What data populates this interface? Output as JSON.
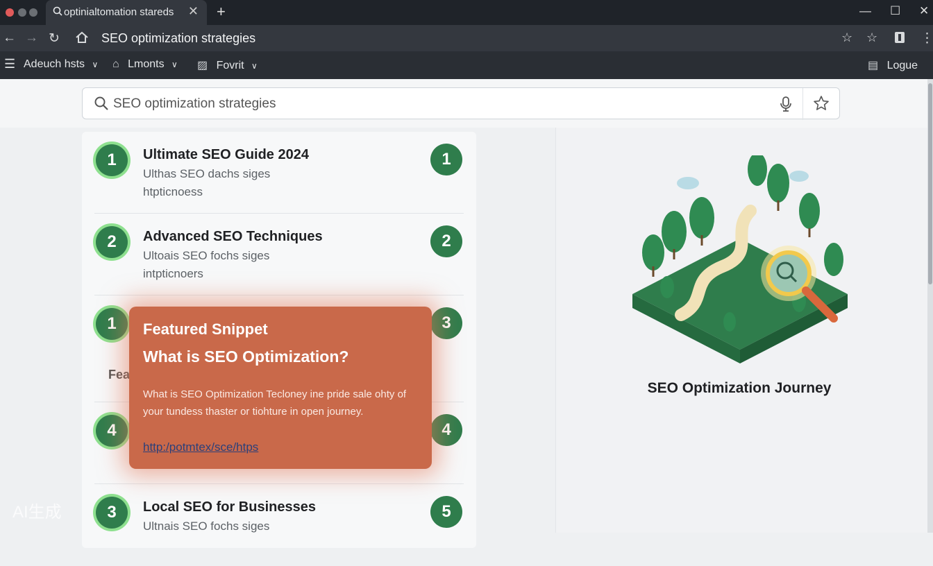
{
  "browser": {
    "tab_title": "optinialtomation stareds",
    "new_tab": "+",
    "address": "SEO optimization strategies"
  },
  "bookmarks": [
    {
      "label": "Adeuch hsts"
    },
    {
      "label": "Lmonts"
    },
    {
      "label": "Fovrit"
    }
  ],
  "bookmark_right": "Logue",
  "search": {
    "query": "SEO optimization strategies"
  },
  "results": [
    {
      "left_num": "1",
      "title": "Ultimate SEO Guide 2024",
      "desc1": "Ulthas SEO dachs siges",
      "desc2": "htpticnoess",
      "right_num": "1"
    },
    {
      "left_num": "2",
      "title": "Advanced SEO Techniques",
      "desc1": "Ultoais SEO fochs siges",
      "desc2": "intpticnoers",
      "right_num": "2"
    },
    {
      "left_num": "1",
      "title": "",
      "desc1": "",
      "desc2": "",
      "right_num": "3"
    },
    {
      "left_num": "4",
      "title": "",
      "desc1": "",
      "desc2": "",
      "right_num": "4"
    },
    {
      "left_num": "3",
      "title": "Local SEO for Businesses",
      "desc1": "Ultnais SEO fochs siges",
      "desc2": "",
      "right_num": "5"
    }
  ],
  "partial_text": "Fea",
  "snippet": {
    "heading": "Featured Snippet",
    "question": "What is SEO Optimization?",
    "body": "What is SEO Optimization Tecloney ine pride sale ohty of your tundess thaster or tiohture in open journey.",
    "link": "http:/potmtex/sce/htps"
  },
  "illustration": {
    "caption": "SEO Optimization Journey"
  },
  "watermark": "AI生成",
  "colors": {
    "accent_green": "#2f7d4c",
    "snippet_bg": "#c9694a",
    "topbar": "#1f2329"
  }
}
